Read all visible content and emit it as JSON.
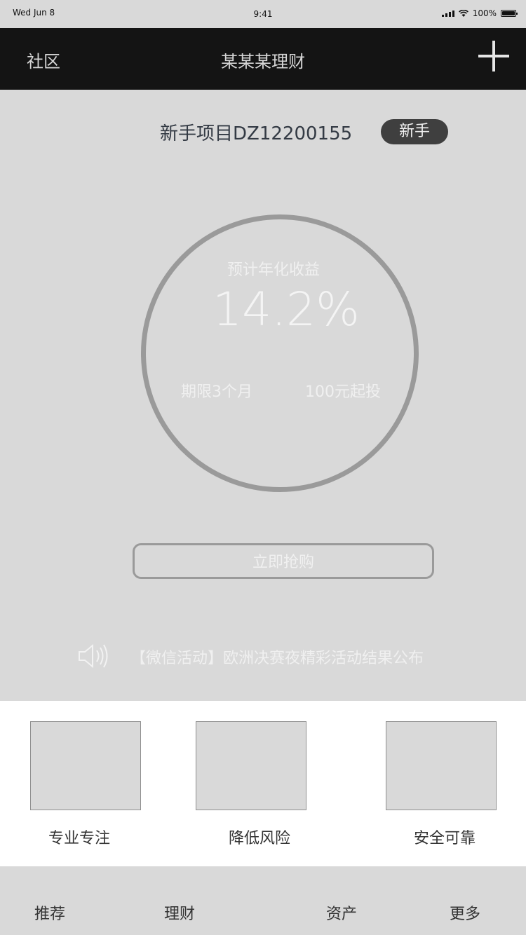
{
  "status_bar": {
    "date": "Wed Jun 8",
    "time": "9:41",
    "battery": "100%"
  },
  "navbar": {
    "left_label": "社区",
    "title": "某某某理财",
    "add_icon": "plus-icon"
  },
  "project": {
    "title": "新手项目DZ12200155",
    "badge": "新手"
  },
  "yield_card": {
    "label": "预计年化收益",
    "rate": "14.2%",
    "term": "期限3个月",
    "min_investment": "100元起投"
  },
  "buy_button": {
    "label": "立即抢购"
  },
  "notice": {
    "icon": "speaker-icon",
    "text": "【微信活动】欧洲决赛夜精彩活动结果公布"
  },
  "features": [
    {
      "label": "专业专注"
    },
    {
      "label": "降低风险"
    },
    {
      "label": "安全可靠"
    }
  ],
  "tabbar": {
    "tabs": [
      {
        "label": "推荐"
      },
      {
        "label": "理财"
      },
      {
        "label": "资产"
      },
      {
        "label": "更多"
      }
    ]
  },
  "colors": {
    "background": "#d9d9d9",
    "navbar": "#141414",
    "badge": "#3f3f3f",
    "ring": "#9a9a9a"
  }
}
